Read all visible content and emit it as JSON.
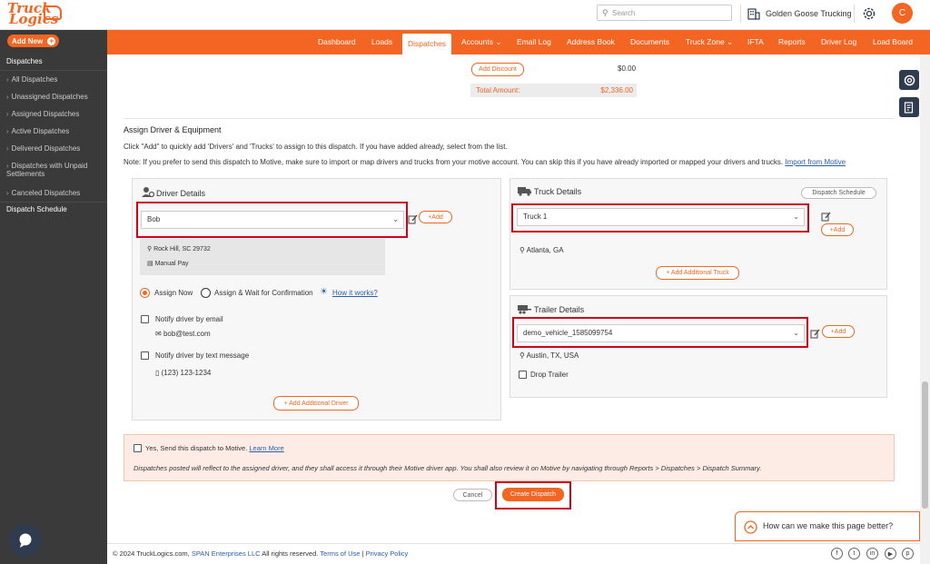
{
  "brand": {
    "logo_line1": "Truck",
    "logo_line2": "Logics",
    "accent": "#f26522",
    "dark": "#2f3b4e"
  },
  "header": {
    "search_placeholder": "Search",
    "company": "Golden Goose Trucking",
    "avatar_initial": "C"
  },
  "nav": {
    "items": [
      "Dashboard",
      "Loads",
      "Dispatches",
      "Accounts",
      "Email Log",
      "Address Book",
      "Documents",
      "Truck Zone",
      "IFTA",
      "Reports",
      "Driver Log",
      "Load Board"
    ],
    "active": "Dispatches"
  },
  "sidebar": {
    "add_new": "Add New",
    "section": "Dispatches",
    "items": [
      "All Dispatches",
      "Unassigned Dispatches",
      "Assigned Dispatches",
      "Active Dispatches",
      "Delivered Dispatches",
      "Dispatches with Unpaid Settlements",
      "Canceled Dispatches"
    ],
    "schedule": "Dispatch Schedule"
  },
  "summary": {
    "add_discount": "Add Discount",
    "discount_value": "$0.00",
    "total_label": "Total Amount:",
    "total_value": "$2,336.00"
  },
  "assign": {
    "title": "Assign Driver & Equipment",
    "instruction": "Click \"Add\" to quickly add 'Drivers' and 'Trucks' to assign to this dispatch. If you have added already, select from the list.",
    "note": "Note: If you prefer to send this dispatch to Motive, make sure to import or map drivers and trucks from your motive account. You can skip this if you have already imported or mapped your drivers and trucks.",
    "import_link": "Import from Motive"
  },
  "driver": {
    "title": "Driver Details",
    "selected": "Bob",
    "add": "+Add",
    "location": "Rock Hill, SC 29732",
    "pay": "Manual Pay",
    "assign_now": "Assign Now",
    "assign_wait": "Assign & Wait for Confirmation",
    "how_it_works": "How it works?",
    "notify_email": "Notify driver by email",
    "email": "bob@test.com",
    "notify_text": "Notify driver by text message",
    "phone": "(123) 123-1234",
    "add_additional": "+ Add Additional Driver"
  },
  "truck": {
    "title": "Truck Details",
    "schedule_btn": "Dispatch Schedule",
    "selected": "Truck 1",
    "add": "+Add",
    "location": "Atlanta, GA",
    "add_additional": "+ Add Additional Truck"
  },
  "trailer": {
    "title": "Trailer Details",
    "selected": "demo_vehicle_1585099754",
    "add": "+Add",
    "location": "Austin, TX, USA",
    "drop": "Drop Trailer"
  },
  "motive": {
    "checkbox": "Yes, Send this dispatch to Motive.",
    "learn_more": "Learn More",
    "info": "Dispatches posted will reflect to the assigned driver, and they shall access it through their Motive driver app. You shall also review it on Motive by navigating through Reports > Dispatches > Dispatch Summary."
  },
  "actions": {
    "cancel": "Cancel",
    "create": "Create Dispatch"
  },
  "feedback": "How can we make this page better?",
  "footer": {
    "copyright": "© 2024 TruckLogics.com,",
    "company": "SPAN Enterprises LLC",
    "rights": "All rights reserved.",
    "terms": "Terms of Use",
    "sep": "|",
    "privacy": "Privacy Policy"
  },
  "social_icons": [
    "facebook-icon",
    "twitter-icon",
    "linkedin-icon",
    "youtube-icon",
    "pinterest-icon"
  ]
}
